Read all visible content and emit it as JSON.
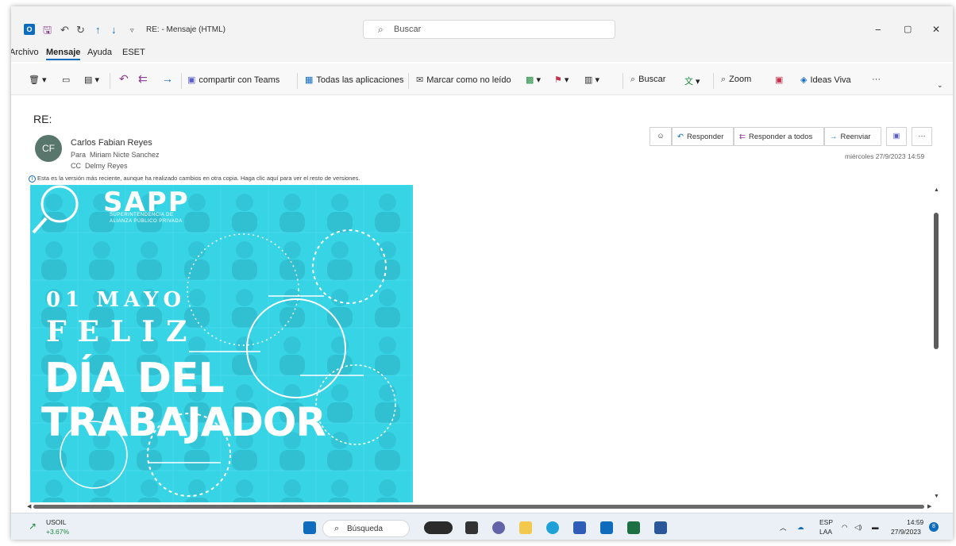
{
  "titlebar": {
    "logo": "O",
    "title": "RE: - Mensaje (HTML)",
    "search_placeholder": "Buscar",
    "minimize": "−",
    "restore": "▢",
    "close": "✕"
  },
  "menu": {
    "items": [
      "Archivo",
      "Mensaje",
      "Ayuda",
      "ESET"
    ],
    "active": "Mensaje"
  },
  "ribbon": {
    "teams": "compartir con Teams",
    "apps": "Todas las aplicaciones",
    "unread": "Marcar como no leído",
    "search": "Buscar",
    "zoom": "Zoom",
    "ideas": "Ideas Viva",
    "more": "···"
  },
  "message": {
    "subject": "RE:",
    "avatar_initials": "CF",
    "sender": "Carlos Fabian Reyes",
    "to_label": "Para",
    "to": "Miriam Nicte Sanchez",
    "cc_label": "CC",
    "cc": "Delmy Reyes",
    "info_icon": "i",
    "info": "Esta es la versión más reciente, aunque ha realizado cambios en otra copia. Haga clic aquí para ver el resto de versiones.",
    "date": "miércoles 27/9/2023 14:59",
    "actions": {
      "reply": "Responder",
      "reply_all": "Responder a todos",
      "forward": "Reenviar",
      "more": "···"
    }
  },
  "banner": {
    "logo": "SAPP",
    "logo_sub_1": "SUPERINTENDENCIA DE",
    "logo_sub_2": "ALIANZA PÚBLICO PRIVADA",
    "date": "01 MAYO",
    "feliz": "FELIZ",
    "dia": "DÍA DEL",
    "trabajador": "TRABAJADOR"
  },
  "taskbar": {
    "stock_name": "USOIL",
    "stock_change": "+3.67%",
    "search": "Búsqueda",
    "lang_1": "ESP",
    "lang_2": "LAA",
    "time": "14:59",
    "date": "27/9/2023",
    "notif": "8"
  },
  "colors": {
    "accent": "#0f6cbd",
    "banner": "#33cfe0",
    "avatar": "#58766c"
  }
}
